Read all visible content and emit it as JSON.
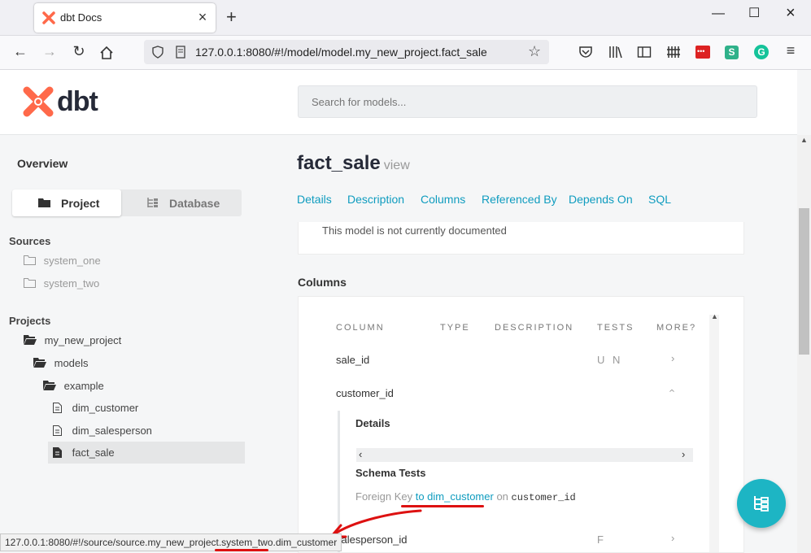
{
  "browser": {
    "tab_title": "dbt Docs",
    "url": "127.0.0.1:8080/#!/model/model.my_new_project.fact_sale",
    "new_tab": "+",
    "status_url": "127.0.0.1:8080/#!/source/source.my_new_project.system_two.dim_customer"
  },
  "header": {
    "logo": "dbt",
    "search_placeholder": "Search for models..."
  },
  "sidebar": {
    "overview": "Overview",
    "toggle": {
      "project": "Project",
      "database": "Database"
    },
    "sources_title": "Sources",
    "sources": [
      "system_one",
      "system_two"
    ],
    "projects_title": "Projects",
    "tree": {
      "project": "my_new_project",
      "models": "models",
      "example": "example",
      "files": [
        "dim_customer",
        "dim_salesperson",
        "fact_sale"
      ]
    }
  },
  "main": {
    "title": "fact_sale",
    "kind": "view",
    "anchors": [
      "Details",
      "Description",
      "Columns",
      "Referenced By",
      "Depends On",
      "SQL"
    ],
    "description": "This model is not currently documented",
    "columns_heading": "Columns",
    "table_headers": [
      "COLUMN",
      "TYPE",
      "DESCRIPTION",
      "TESTS",
      "MORE?"
    ],
    "rows": [
      {
        "name": "sale_id",
        "tests": "U N"
      },
      {
        "name": "customer_id",
        "tests": ""
      },
      {
        "name": "salesperson_id",
        "tests": "F"
      }
    ],
    "detail": {
      "details_heading": "Details",
      "schema_tests_heading": "Schema Tests",
      "fk_prefix": "Foreign Key",
      "fk_link": "to dim_customer",
      "fk_on": "on",
      "fk_column": "customer_id"
    }
  },
  "colors": {
    "accent": "#0f9cbf",
    "fab": "#1db5c4",
    "logo": "#ff694a"
  }
}
